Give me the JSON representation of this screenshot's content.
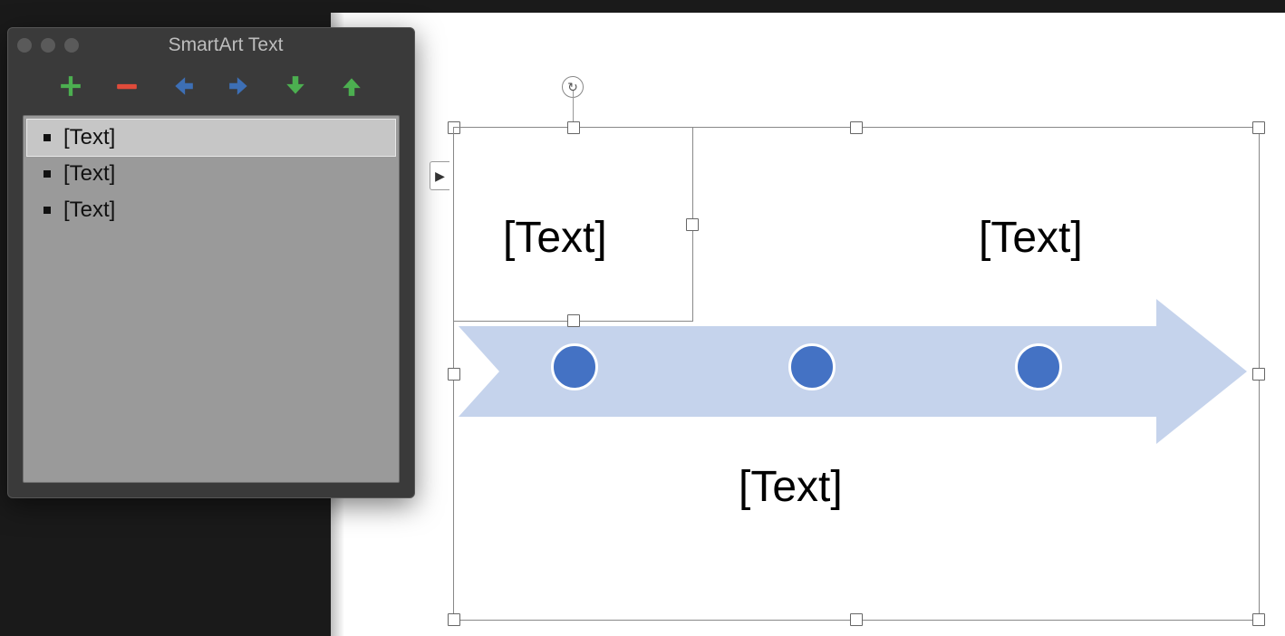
{
  "pane": {
    "title": "SmartArt Text",
    "toolbar": {
      "add": "add-bullet",
      "remove": "remove-bullet",
      "promote": "promote",
      "demote": "demote",
      "move_down": "move-down",
      "move_up": "move-up"
    },
    "items": [
      {
        "label": "[Text]",
        "selected": true
      },
      {
        "label": "[Text]",
        "selected": false
      },
      {
        "label": "[Text]",
        "selected": false
      }
    ]
  },
  "graphic": {
    "placeholder1": "[Text]",
    "placeholder2": "[Text]",
    "placeholder3": "[Text]",
    "arrow_color": "#c5d3ec",
    "circle_color": "#4472c4"
  },
  "icons": {
    "rotate": "↻",
    "expand": "▶"
  }
}
